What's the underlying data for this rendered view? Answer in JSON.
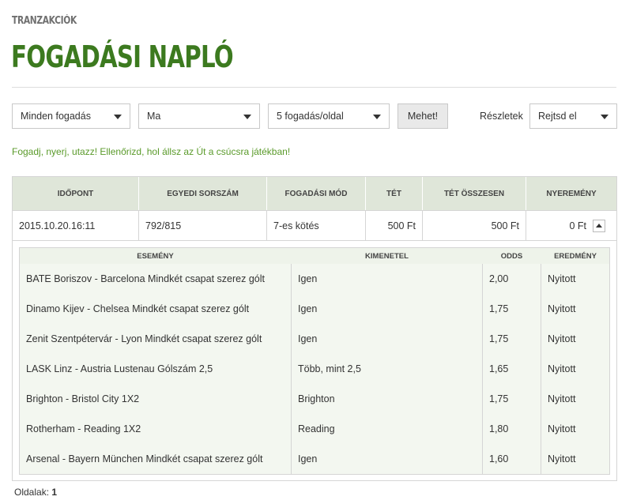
{
  "header": {
    "breadcrumb": "TRANZAKCIÓK",
    "title": "FOGADÁSI NAPLÓ"
  },
  "filters": {
    "type_select": "Minden fogadás",
    "date_select": "Ma",
    "per_page_select": "5 fogadás/oldal",
    "go_button": "Mehet!",
    "details_label": "Részletek",
    "details_select": "Rejtsd el"
  },
  "promo_text": "Fogadj, nyerj, utazz! Ellenőrizd, hol állsz az Út a csúcsra játékban!",
  "bets_table": {
    "columns": [
      "IDŐPONT",
      "EGYEDI SORSZÁM",
      "FOGADÁSI MÓD",
      "TÉT",
      "TÉT ÖSSZESEN",
      "NYEREMÉNY"
    ],
    "rows": [
      {
        "time": "2015.10.20.16:11",
        "serial": "792/815",
        "mode": "7-es kötés",
        "stake": "500 Ft",
        "total_stake": "500 Ft",
        "winnings": "0 Ft"
      }
    ]
  },
  "details_table": {
    "columns": [
      "ESEMÉNY",
      "KIMENETEL",
      "ODDS",
      "EREDMÉNY"
    ],
    "rows": [
      {
        "event": "BATE Boriszov - Barcelona Mindkét csapat szerez gólt",
        "outcome": "Igen",
        "odds": "2,00",
        "result": "Nyitott"
      },
      {
        "event": "Dinamo Kijev - Chelsea Mindkét csapat szerez gólt",
        "outcome": "Igen",
        "odds": "1,75",
        "result": "Nyitott"
      },
      {
        "event": "Zenit Szentpétervár - Lyon Mindkét csapat szerez gólt",
        "outcome": "Igen",
        "odds": "1,75",
        "result": "Nyitott"
      },
      {
        "event": "LASK Linz - Austria Lustenau Gólszám 2,5",
        "outcome": "Több, mint 2,5",
        "odds": "1,65",
        "result": "Nyitott"
      },
      {
        "event": "Brighton - Bristol City 1X2",
        "outcome": "Brighton",
        "odds": "1,75",
        "result": "Nyitott"
      },
      {
        "event": "Rotherham - Reading 1X2",
        "outcome": "Reading",
        "odds": "1,80",
        "result": "Nyitott"
      },
      {
        "event": "Arsenal - Bayern München Mindkét csapat szerez gólt",
        "outcome": "Igen",
        "odds": "1,60",
        "result": "Nyitott"
      }
    ]
  },
  "pagination": {
    "label": "Oldalak:",
    "current": "1"
  },
  "colors": {
    "title_green": "#3c7a1f",
    "promo_green": "#5a9a2a",
    "header_bg": "#dfe6d9"
  }
}
